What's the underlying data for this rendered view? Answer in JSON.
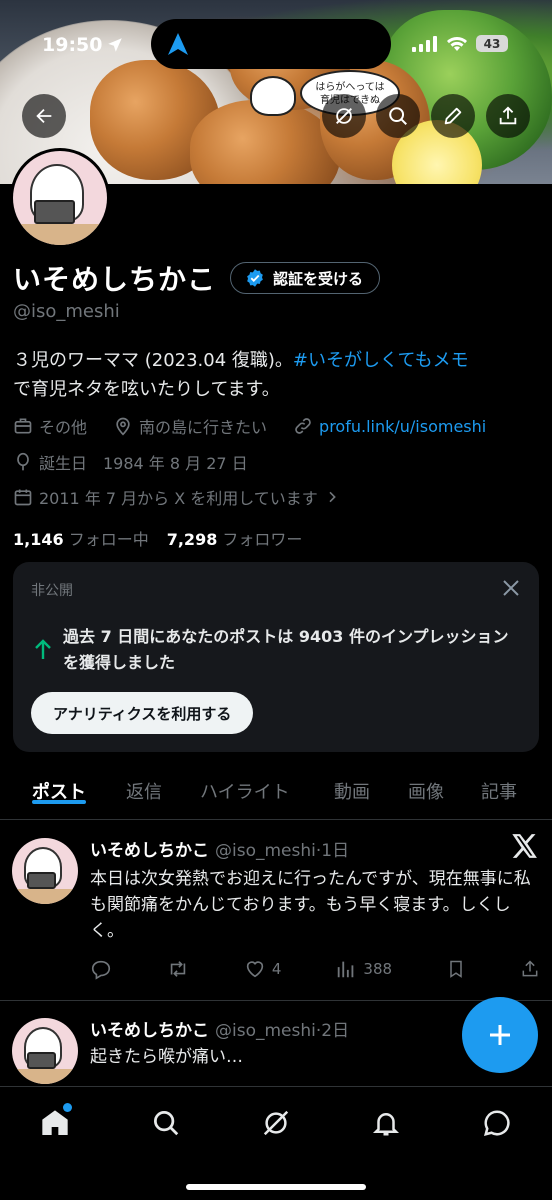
{
  "status_bar": {
    "time": "19:50",
    "battery": "43"
  },
  "banner": {
    "bubble_text": "はらがへっては\n育児はできぬ"
  },
  "profile": {
    "name": "いそめしちかこ",
    "verify_label": "認証を受ける",
    "handle": "@iso_meshi",
    "bio_text": "３児のワーママ (2023.04 復職)。",
    "bio_hashtag": "#いそがしくてもメモ",
    "bio_text2": "で育児ネタを呟いたりしてます。",
    "category": "その他",
    "location": "南の島に行きたい",
    "link": "profu.link/u/isomeshi",
    "birthday": "誕生日　1984 年 8 月 27 日",
    "joined": "2011 年 7 月から X を利用しています",
    "following_count": "1,146",
    "following_label": "フォロー中",
    "followers_count": "7,298",
    "followers_label": "フォロワー"
  },
  "private_card": {
    "title": "非公開",
    "message": "過去 7 日間にあなたのポストは 9403 件のインプレッションを獲得しました",
    "button": "アナリティクスを利用する"
  },
  "tabs": [
    "ポスト",
    "返信",
    "ハイライト",
    "動画",
    "画像",
    "記事"
  ],
  "posts": [
    {
      "name": "いそめしちかこ",
      "handle": "@iso_meshi",
      "time": "·1日",
      "text": "本日は次女発熱でお迎えに行ったんですが、現在無事に私も関節痛をかんじております。もう早く寝ます。しくしく。",
      "likes": "4",
      "views": "388"
    },
    {
      "name": "いそめしちかこ",
      "handle": "@iso_meshi",
      "time": "·2日",
      "text": "起きたら喉が痛い…"
    }
  ],
  "colors": {
    "accent": "#1d9bf0",
    "background": "#000000",
    "muted": "#71767b"
  },
  "icons": {
    "nav": [
      "home-icon",
      "search-icon",
      "grok-icon",
      "bell-icon",
      "messages-icon"
    ],
    "banner_buttons": [
      "back-arrow-icon",
      "grok-icon",
      "search-icon",
      "edit-icon",
      "share-icon"
    ]
  }
}
